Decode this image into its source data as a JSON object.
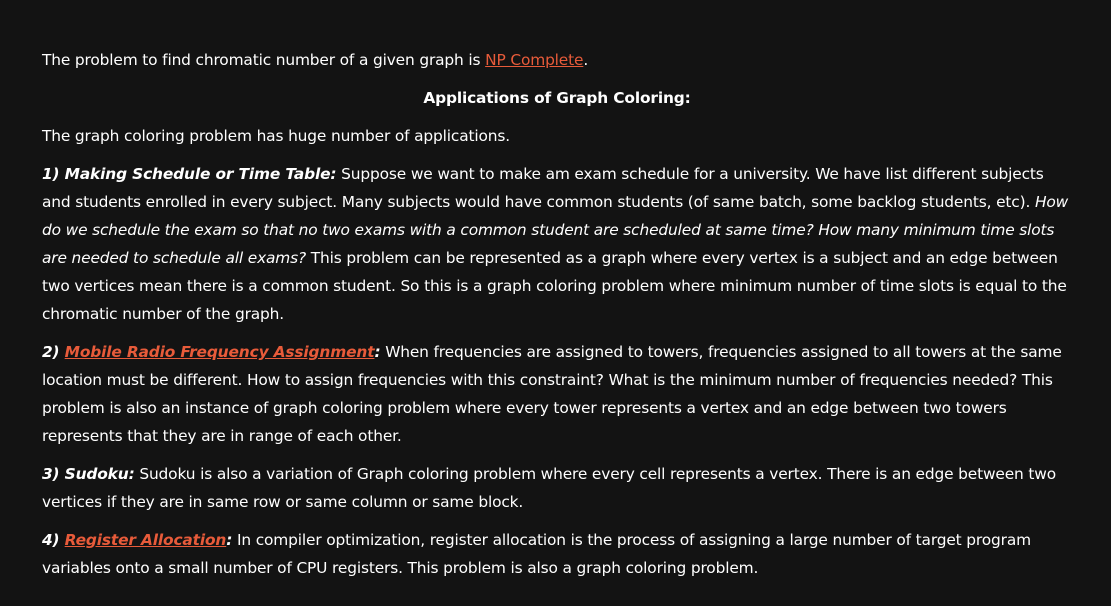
{
  "intro": {
    "before_link": "The problem to find chromatic number of a given graph is ",
    "link": "NP Complete",
    "after_link": "."
  },
  "heading": "Applications of Graph Coloring:",
  "summary": "The graph coloring problem has huge number of applications.",
  "app1": {
    "lead": "1) Making Schedule or Time Table:",
    "text1": " Suppose we want to make am exam schedule for a university. We have list different subjects and students enrolled in every subject. Many subjects would have common students (of same batch, some backlog students, etc). ",
    "italic": "How do we schedule the exam so that no two exams with a common student are scheduled at same time? How many minimum time slots are needed to schedule all exams?",
    "text2": " This problem can be represented as a graph where every vertex is a subject and an edge between two vertices mean there is a common student. So this is a graph coloring problem where minimum number of time slots is equal to the chromatic number of the graph."
  },
  "app2": {
    "lead_prefix": "2) ",
    "link": "Mobile Radio Frequency Assignment",
    "lead_suffix": ":",
    "text": " When frequencies are assigned to towers, frequencies assigned to all towers at the same location must be different. How to assign frequencies with this constraint? What is the minimum number of frequencies needed? This problem is also an instance of graph coloring problem where every tower represents a vertex and an edge between two towers represents that they are in range of each other."
  },
  "app3": {
    "lead": "3) Sudoku:",
    "text": " Sudoku is also a variation of Graph coloring problem where every cell represents a vertex. There is an edge between two vertices if they are in same row or same column or same block."
  },
  "app4": {
    "lead_prefix": "4) ",
    "link": "Register Allocation",
    "lead_suffix": ":",
    "text": " In compiler optimization, register allocation is the process of assigning a large number of target program variables onto a small number of CPU registers. This problem is also a graph coloring problem."
  }
}
